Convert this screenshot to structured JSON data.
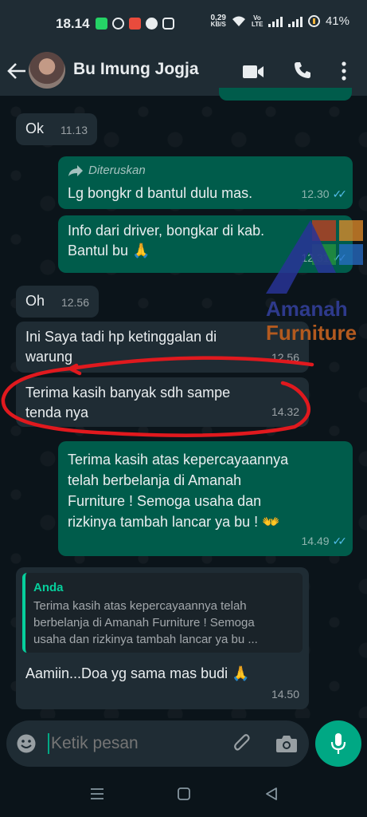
{
  "status_bar": {
    "time": "18.14",
    "data_speed": "0,29",
    "data_unit": "KB/S",
    "volte": "Vo LTE",
    "battery": "41%"
  },
  "header": {
    "contact_name": "Bu Imung Jogja",
    "icons": [
      "back-arrow-icon",
      "video-call-icon",
      "phone-icon",
      "more-options-icon"
    ]
  },
  "messages": [
    {
      "dir": "in",
      "text": "Ok",
      "time": "11.13"
    },
    {
      "dir": "out",
      "forwarded_label": "Diteruskan",
      "text": "Lg bongkr d bantul dulu  mas.",
      "time": "12.30",
      "read": true
    },
    {
      "dir": "out",
      "text_line1": "Info dari driver, bongkar di kab.",
      "text_line2": "Bantul bu 🙏",
      "time": "12.31",
      "read": true
    },
    {
      "dir": "in",
      "text": "Oh",
      "time": "12.56"
    },
    {
      "dir": "in",
      "text_line1": "Ini Saya tadi hp ketinggalan di",
      "text_line2": "warung",
      "time": "12.56"
    },
    {
      "dir": "in",
      "text_line1": "Terima kasih banyak sdh sampe",
      "text_line2": "tenda nya",
      "time": "14.32"
    },
    {
      "dir": "out",
      "line1": "Terima kasih atas kepercayaannya",
      "line2": "telah berbelanja di Amanah",
      "line3": "Furniture ! Semoga usaha dan",
      "line4": "rizkinya tambah lancar ya bu !  👐",
      "time": "14.49",
      "read": true
    },
    {
      "dir": "in",
      "quote_name": "Anda",
      "quote_line1": "Terima kasih atas kepercayaannya telah",
      "quote_line2": "berbelanja di Amanah Furniture ! Semoga",
      "quote_line3": "usaha dan rizkinya tambah lancar ya bu ...",
      "text": "Aamiin...Doa yg sama mas budi 🙏",
      "time": "14.50"
    }
  ],
  "watermark": {
    "line1": "Amanah",
    "line2": "Furniture"
  },
  "composer": {
    "placeholder": "Ketik pesan"
  },
  "colors": {
    "incoming": "#1f2c34",
    "outgoing": "#005c4b",
    "accent": "#00a884",
    "read_tick": "#53bdeb",
    "annotation": "#e0191e"
  }
}
